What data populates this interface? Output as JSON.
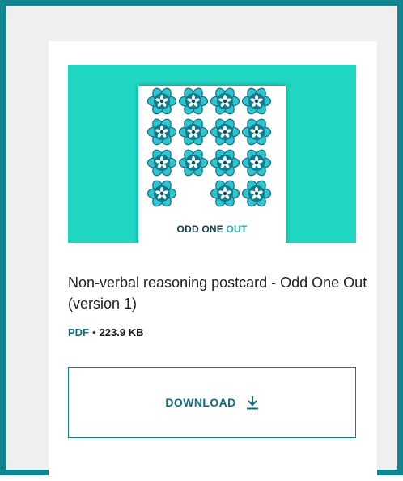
{
  "thumbnail": {
    "caption_main": "ODD ONE ",
    "caption_accent": "OUT",
    "flowers": {
      "rows": 4,
      "cols": 4,
      "missing_index": 13
    }
  },
  "resource": {
    "title": "Non-verbal reasoning postcard - Odd One Out (version 1)",
    "file_type": "PDF",
    "separator": "•",
    "file_size": "223.9 KB"
  },
  "download": {
    "label": "DOWNLOAD",
    "icon": "download-arrow-icon"
  },
  "colors": {
    "frame": "#10858f",
    "background": "#efefef",
    "thumbnail_bg": "#1fd6c2",
    "accent": "#0f6d78"
  }
}
